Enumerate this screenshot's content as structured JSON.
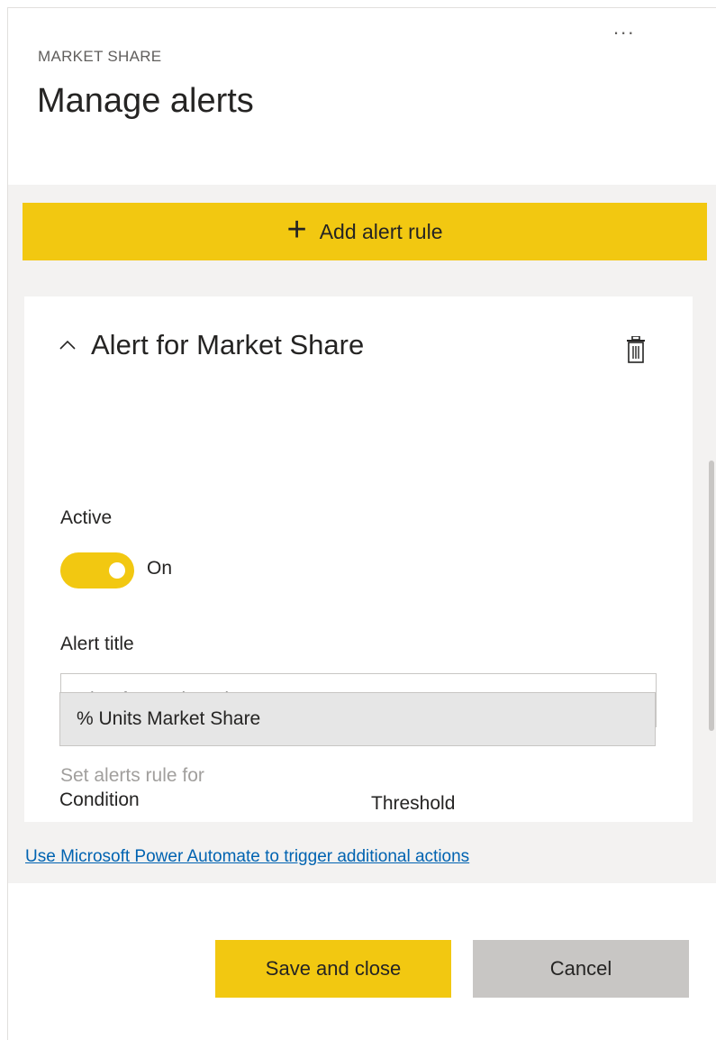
{
  "header": {
    "more_icon": "more-icon",
    "more_label": "...",
    "subtitle": "MARKET SHARE",
    "title": "Manage alerts"
  },
  "toolbar": {
    "add_icon": "plus-icon",
    "add_label": "Add alert rule"
  },
  "alert": {
    "collapse_icon": "chevron-up-icon",
    "title": "Alert for Market Share",
    "delete_icon": "trash-icon",
    "active_label": "Active",
    "active_state": "On",
    "active_on": true,
    "alert_title_label": "Alert title",
    "alert_title_value": "Alert for Market Share",
    "rule_for_label": "Set alerts rule for",
    "rule_for_value": "% Units Market Share",
    "condition_label": "Condition",
    "threshold_label": "Threshold"
  },
  "footer": {
    "flow_link": "Use Microsoft Power Automate to trigger additional actions",
    "save_label": "Save and close",
    "cancel_label": "Cancel"
  },
  "colors": {
    "accent": "#f2c811",
    "link": "#0063b1",
    "panel_bg": "#f3f2f1"
  }
}
